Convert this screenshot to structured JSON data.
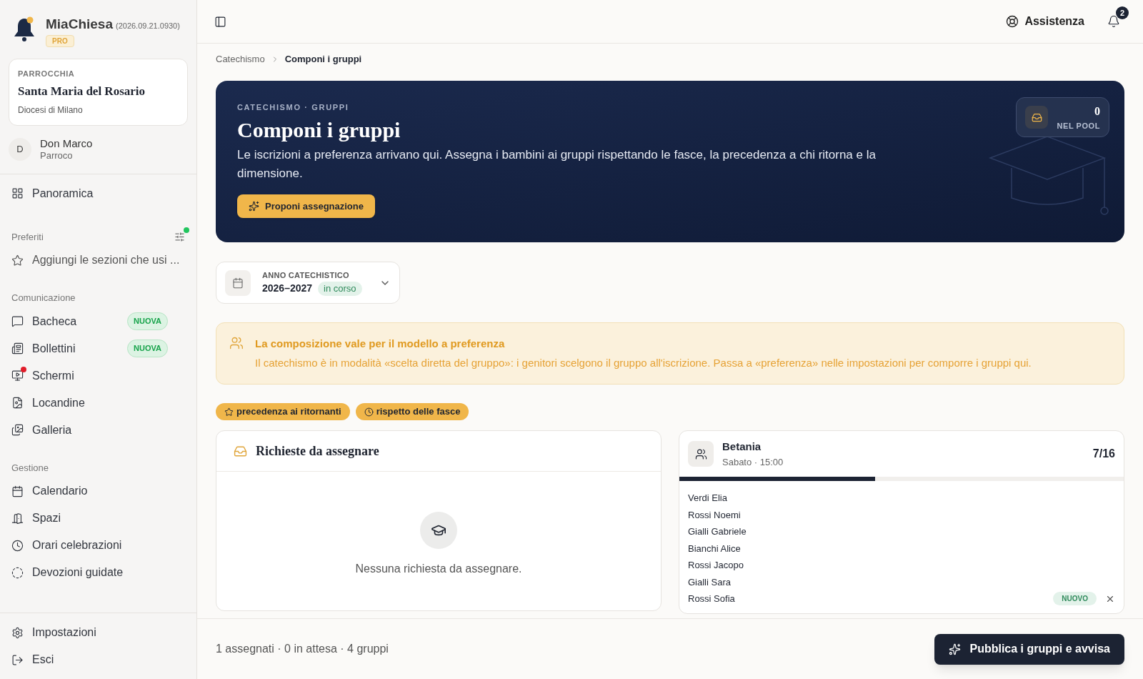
{
  "app": {
    "name": "MiaChiesa",
    "version": "(2026.09.21.0930)",
    "plan": "PRO"
  },
  "parish": {
    "label": "PARROCCHIA",
    "name": "Santa Maria del Rosario",
    "diocese": "Diocesi di Milano"
  },
  "user": {
    "initial": "D",
    "name": "Don Marco",
    "role": "Parroco"
  },
  "overview": {
    "label": "Panoramica",
    "selected": false
  },
  "favorites": {
    "title": "Preferiti",
    "settings_dot": true,
    "hint": "Aggiungi le sezioni che usi ..."
  },
  "sections": [
    {
      "title": "Comunicazione",
      "items": [
        {
          "label": "Bacheca",
          "badge": "NUOVA",
          "dot": false
        },
        {
          "label": "Bollettini",
          "badge": "NUOVA",
          "dot": false
        },
        {
          "label": "Schermi",
          "dot": true
        },
        {
          "label": "Locandine",
          "dot": false
        },
        {
          "label": "Galleria",
          "dot": false
        }
      ]
    },
    {
      "title": "Gestione",
      "items": [
        {
          "label": "Calendario",
          "dot": false
        },
        {
          "label": "Spazi",
          "dot": false
        },
        {
          "label": "Orari celebrazioni",
          "dot": false
        },
        {
          "label": "Devozioni guidate",
          "dot": false
        }
      ]
    }
  ],
  "footer_items": [
    {
      "label": "Impostazioni"
    },
    {
      "label": "Esci"
    }
  ],
  "header": {
    "help": "Assistenza",
    "notifications": "2"
  },
  "breadcrumb": [
    {
      "label": "Catechismo",
      "current": false
    },
    {
      "label": "Componi i gruppi",
      "current": true
    }
  ],
  "hero": {
    "eyebrow": "CATECHISMO · GRUPPI",
    "title": "Componi i gruppi",
    "text": "Le iscrizioni a preferenza arrivano qui. Assegna i bambini ai gruppi rispettando le fasce, la precedenza a chi ritorna e la dimensione.",
    "button": "Proponi assegnazione",
    "pool_count": "0",
    "pool_label": "NEL POOL"
  },
  "year": {
    "label": "ANNO CATECHISTICO",
    "value": "2026–2027",
    "status": "in corso"
  },
  "notice": {
    "title": "La composizione vale per il modello a preferenza",
    "text": "Il catechismo è in modalità «scelta diretta del gruppo»: i genitori scelgono il gruppo all'iscrizione. Passa a «preferenza» nelle impostazioni per comporre i gruppi qui."
  },
  "rules": [
    {
      "kind": "star",
      "label": "precedenza ai ritornanti"
    },
    {
      "kind": "clock",
      "label": "rispetto delle fasce"
    }
  ],
  "requests": {
    "title": "Richieste da assegnare",
    "empty": "Nessuna richiesta da assegnare."
  },
  "group": {
    "name": "Betania",
    "schedule": "Sabato · 15:00",
    "count": "7/16",
    "level": 0.44,
    "members": [
      {
        "name": "Verdi Elia",
        "removable": false
      },
      {
        "name": "Rossi Noemi",
        "removable": false
      },
      {
        "name": "Gialli Gabriele",
        "removable": false
      },
      {
        "name": "Bianchi Alice",
        "removable": false
      },
      {
        "name": "Rossi Jacopo",
        "removable": false
      },
      {
        "name": "Gialli Sara",
        "removable": false
      },
      {
        "name": "Rossi Sofia",
        "badge": "NUOVO",
        "removable": true
      }
    ]
  },
  "summary": "1 assegnati · 0 in attesa · 4 gruppi",
  "publish_button": "Pubblica i gruppi e avvisa"
}
